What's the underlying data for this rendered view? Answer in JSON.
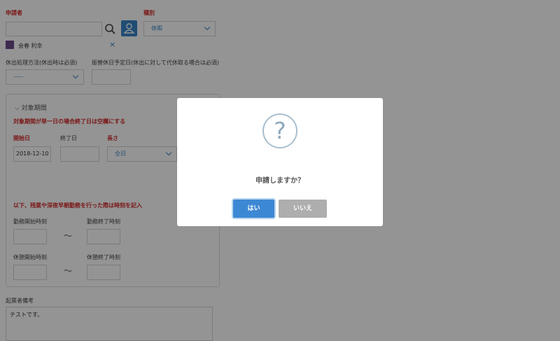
{
  "applicant": {
    "label": "申請者",
    "name": "会春 利幸"
  },
  "type": {
    "label": "種別",
    "value": "休暇"
  },
  "method": {
    "label": "休出処理方法(休出時は必須)",
    "value": "-----"
  },
  "substitute": {
    "label": "振替休日予定日(休出に対して代休取る場合は必須)"
  },
  "period": {
    "title": "対象期間",
    "note": "対象期間が単一日の場合終了日は空欄にする",
    "start_label": "開始日",
    "start_value": "2018-12-10",
    "end_label": "終了日",
    "length_label": "長さ",
    "length_value": "全日",
    "overtime_note": "以下、残業や深夜早朝勤務を行った際は時刻を記入",
    "work_start_label": "勤務開始時刻",
    "work_end_label": "勤務終了時刻",
    "break_start_label": "休憩開始時刻",
    "break_end_label": "休憩終了時刻",
    "tilde": "〜"
  },
  "remarks": {
    "label": "起票者備考",
    "value": "テストです。"
  },
  "modal": {
    "icon": "?",
    "message": "申請しますか？",
    "yes": "はい",
    "no": "いいえ"
  }
}
